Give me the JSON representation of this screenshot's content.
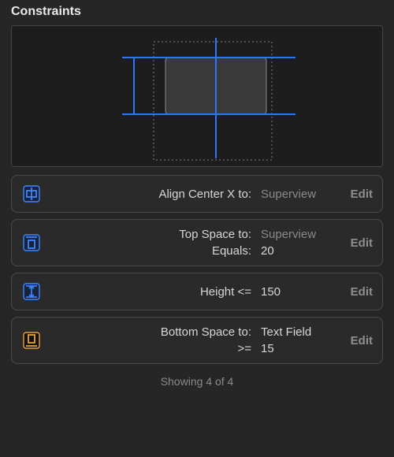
{
  "header": {
    "title": "Constraints"
  },
  "constraints": [
    {
      "icon": "align-center-x-icon",
      "selected": true,
      "lines": [
        {
          "label": "Align Center X to:",
          "value": "Superview",
          "dim": true
        }
      ],
      "edit_label": "Edit"
    },
    {
      "icon": "top-space-icon",
      "selected": true,
      "lines": [
        {
          "label": "Top Space to:",
          "value": "Superview",
          "dim": true
        },
        {
          "label": "Equals:",
          "value": "20",
          "dim": false
        }
      ],
      "edit_label": "Edit"
    },
    {
      "icon": "height-icon",
      "selected": true,
      "lines": [
        {
          "label": "Height <=",
          "value": "150",
          "dim": false
        }
      ],
      "edit_label": "Edit"
    },
    {
      "icon": "bottom-space-icon",
      "selected": false,
      "lines": [
        {
          "label": "Bottom Space to:",
          "value": "Text Field",
          "dim": false
        },
        {
          "label": ">=",
          "value": "15",
          "dim": false
        }
      ],
      "edit_label": "Edit"
    }
  ],
  "footer": {
    "status": "Showing 4 of 4"
  },
  "colors": {
    "accent": "#2e74ff",
    "accent_light": "#3f85ff"
  }
}
